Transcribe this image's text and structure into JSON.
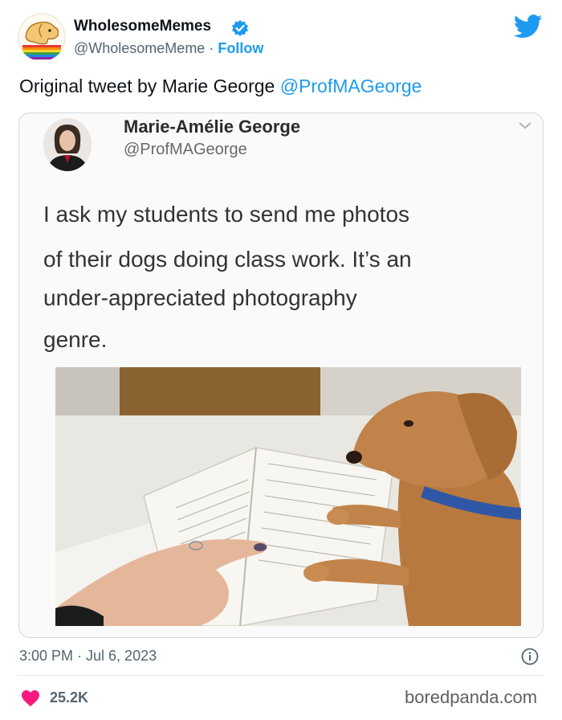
{
  "account": {
    "name": "WholesomeMemes",
    "handle": "@WholesomeMeme",
    "separator": "·",
    "follow_label": "Follow"
  },
  "tweet": {
    "text_prefix": "Original tweet by Marie George ",
    "mention": "@ProfMAGeorge"
  },
  "embedded_tweet": {
    "author_name": "Marie-Amélie George",
    "author_handle": "@ProfMAGeorge",
    "text_lines": [
      "I ask my students to send me photos",
      "of their dogs doing class work. It’s an",
      "under-appreciated photography",
      "genre."
    ]
  },
  "footer": {
    "timestamp": "3:00 PM · Jul 6, 2023",
    "like_count": "25.2K",
    "watermark": "boredpanda.com"
  },
  "colors": {
    "twitter_blue": "#1d9bf0",
    "heart_pink": "#f91880",
    "text_primary": "#0f1419",
    "text_secondary": "#536471"
  },
  "icons": [
    "verified-badge-icon",
    "twitter-bird-icon",
    "chevron-down-icon",
    "info-icon",
    "heart-icon"
  ]
}
